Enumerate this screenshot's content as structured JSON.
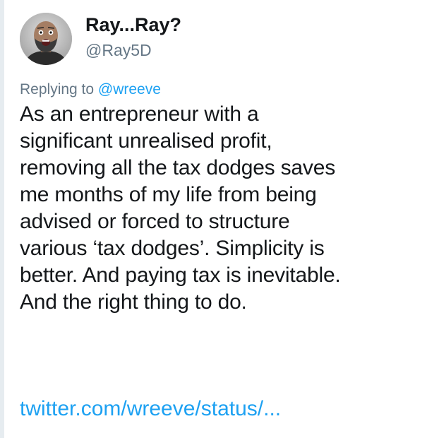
{
  "tweet": {
    "author": {
      "display_name": "Ray...Ray?",
      "handle": "@Ray5D",
      "avatar": "avatar-photo"
    },
    "reply": {
      "prefix": "Replying to ",
      "mention": "@wreeve"
    },
    "text_lines": [
      "As an entrepreneur with a",
      "significant unrealised profit,",
      "removing all the tax dodges saves",
      "me months of my life from being",
      "advised or forced to structure",
      "various ‘tax dodges’. Simplicity is",
      "better. And paying tax is inevitable.",
      "And the right thing to do."
    ],
    "link": "twitter.com/wreeve/status/..."
  },
  "colors": {
    "text": "#14171a",
    "secondary": "#657786",
    "link": "#1da1f2",
    "thread_line": "#e6ecf0"
  }
}
